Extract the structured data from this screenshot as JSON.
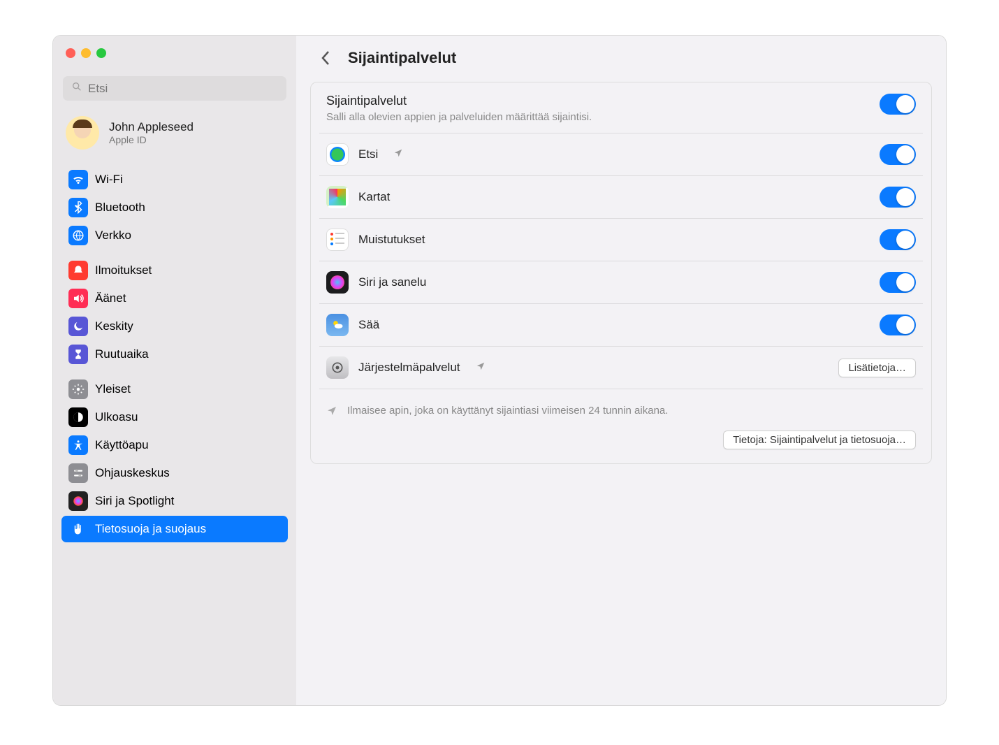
{
  "search": {
    "placeholder": "Etsi"
  },
  "profile": {
    "name": "John Appleseed",
    "id": "Apple ID"
  },
  "sidebar": {
    "group1": [
      {
        "label": "Wi-Fi",
        "bg": "#0a7aff",
        "icon": "wifi"
      },
      {
        "label": "Bluetooth",
        "bg": "#0a7aff",
        "icon": "bluetooth"
      },
      {
        "label": "Verkko",
        "bg": "#0a7aff",
        "icon": "globe"
      }
    ],
    "group2": [
      {
        "label": "Ilmoitukset",
        "bg": "#ff3b30",
        "icon": "bell"
      },
      {
        "label": "Äänet",
        "bg": "#ff2d55",
        "icon": "speaker"
      },
      {
        "label": "Keskity",
        "bg": "#5856d6",
        "icon": "moon"
      },
      {
        "label": "Ruutuaika",
        "bg": "#5856d6",
        "icon": "hourglass"
      }
    ],
    "group3": [
      {
        "label": "Yleiset",
        "bg": "#8e8e93",
        "icon": "gear"
      },
      {
        "label": "Ulkoasu",
        "bg": "#000000",
        "icon": "appearance"
      },
      {
        "label": "Käyttöapu",
        "bg": "#0a7aff",
        "icon": "accessibility"
      },
      {
        "label": "Ohjauskeskus",
        "bg": "#8e8e93",
        "icon": "sliders"
      },
      {
        "label": "Siri ja Spotlight",
        "bg": "#222222",
        "icon": "siri"
      },
      {
        "label": "Tietosuoja ja suojaus",
        "bg": "#0a7aff",
        "icon": "hand",
        "selected": true
      }
    ]
  },
  "header": {
    "title": "Sijaintipalvelut"
  },
  "section": {
    "title": "Sijaintipalvelut",
    "desc": "Salli alla olevien appien ja palveluiden määrittää sijaintisi."
  },
  "apps": [
    {
      "name": "Etsi",
      "icon": "findmy",
      "indicator": true,
      "toggle": true
    },
    {
      "name": "Kartat",
      "icon": "maps",
      "toggle": true
    },
    {
      "name": "Muistutukset",
      "icon": "reminders",
      "toggle": true
    },
    {
      "name": "Siri ja sanelu",
      "icon": "siriapp",
      "toggle": true
    },
    {
      "name": "Sää",
      "icon": "weather",
      "toggle": true
    }
  ],
  "system_row": {
    "name": "Järjestelmäpalvelut",
    "button": "Lisätietoja…"
  },
  "footer": {
    "note": "Ilmaisee apin, joka on käyttänyt sijaintiasi viimeisen 24 tunnin aikana.",
    "button": "Tietoja: Sijaintipalvelut ja tietosuoja…"
  }
}
